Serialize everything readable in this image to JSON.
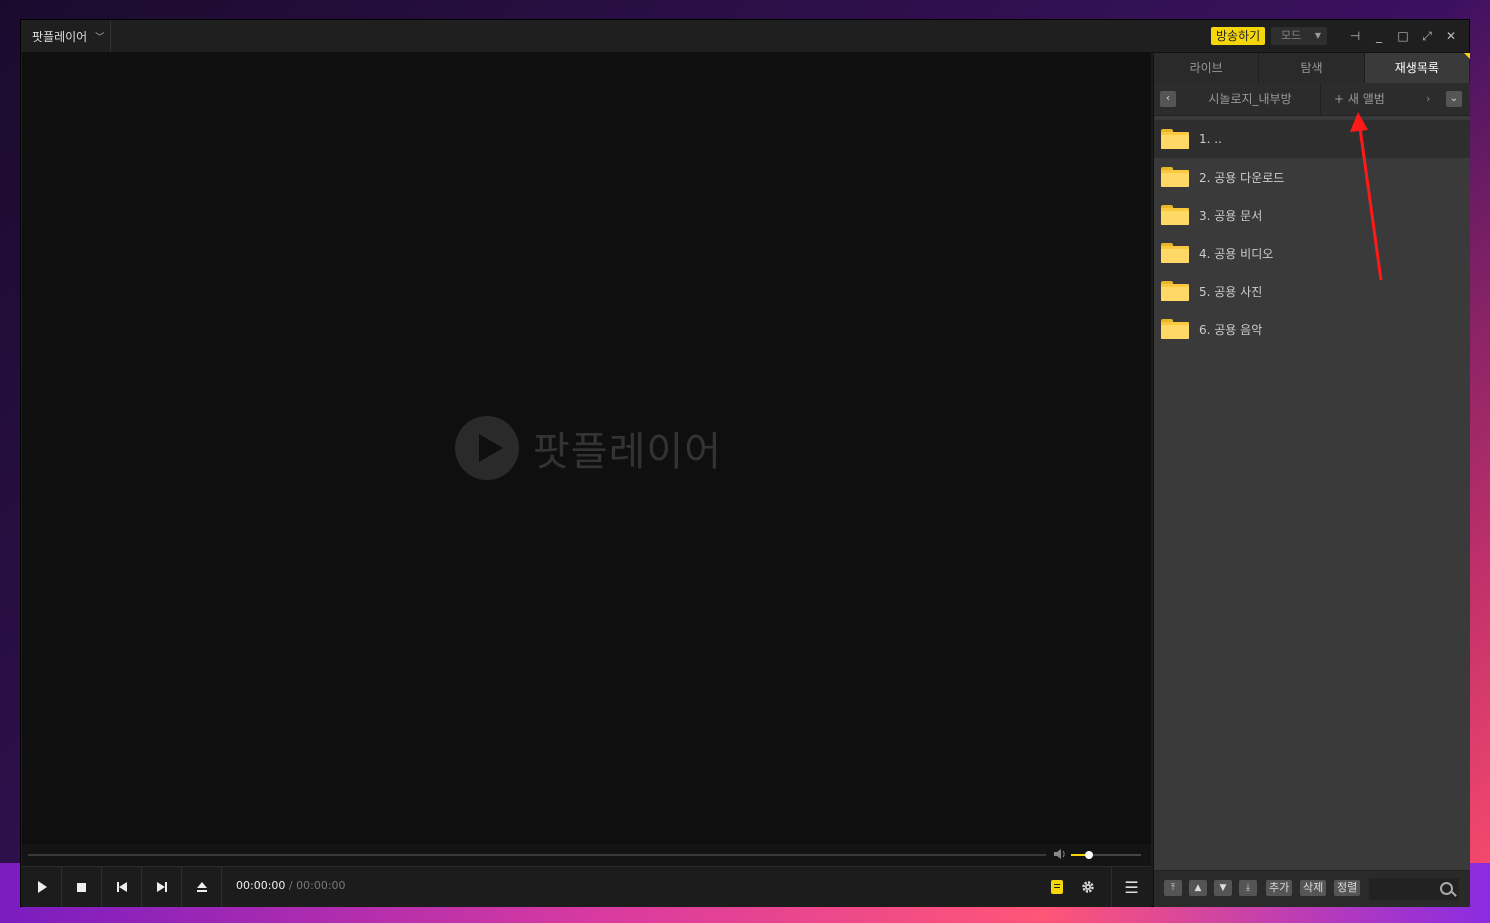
{
  "app": {
    "title": "팟플레이어",
    "broadcast_label": "방송하기",
    "mode_label": "모드"
  },
  "window_controls": {
    "pin": "⊣",
    "minimize": "_",
    "maximize": "□",
    "fullscreen": "⤢",
    "close": "✕"
  },
  "video": {
    "logo_text": "팟플레이어"
  },
  "playback": {
    "current_time": "00:00:00",
    "separator": "/",
    "total_time": "00:00:00",
    "volume_level": 0.25
  },
  "panel": {
    "tabs": [
      {
        "label": "라이브",
        "active": false
      },
      {
        "label": "탐색",
        "active": false
      },
      {
        "label": "재생목록",
        "active": true
      }
    ],
    "album_name": "시놀로지_내부방",
    "new_album_label": "+ 새 앨범",
    "items": [
      {
        "label": "1. ..",
        "selected": true
      },
      {
        "label": "2. 공용 다운로드",
        "selected": false
      },
      {
        "label": "3. 공용 문서",
        "selected": false
      },
      {
        "label": "4. 공용 비디오",
        "selected": false
      },
      {
        "label": "5. 공용 사진",
        "selected": false
      },
      {
        "label": "6. 공용 음악",
        "selected": false
      }
    ],
    "bottom": {
      "add_label": "추가",
      "delete_label": "삭제",
      "sort_label": "정렬"
    }
  },
  "colors": {
    "accent": "#f5d60a",
    "annotation_arrow": "#ff1a1a"
  },
  "icons": [
    "play-icon",
    "stop-icon",
    "previous-icon",
    "next-icon",
    "eject-icon",
    "subtitle-icon",
    "settings-gear-icon",
    "menu-icon",
    "volume-icon",
    "folder-icon",
    "search-icon"
  ]
}
